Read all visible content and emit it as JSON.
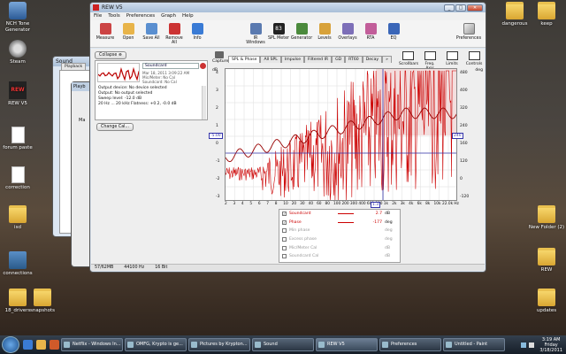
{
  "desktop": {
    "icons_left": [
      {
        "label": "NCH Tone Generator",
        "kind": "app-blue"
      },
      {
        "label": "Steam",
        "kind": "gear"
      },
      {
        "label": "REW V5",
        "kind": "rewicon"
      },
      {
        "label": "forum paste",
        "kind": "doc"
      },
      {
        "label": "correction",
        "kind": "doc"
      },
      {
        "label": "isd",
        "kind": "folder"
      },
      {
        "label": "connections",
        "kind": "conn"
      },
      {
        "label": "18_drivers",
        "kind": "folder"
      },
      {
        "label": "snapshots",
        "kind": "folder"
      }
    ],
    "icons_right": [
      {
        "label": "dangerous",
        "kind": "folder"
      },
      {
        "label": "keep",
        "kind": "folder"
      },
      {
        "label": "New Folder (2)",
        "kind": "folder"
      },
      {
        "label": "REW",
        "kind": "folder"
      },
      {
        "label": "updates",
        "kind": "folder"
      }
    ]
  },
  "sound_dialog": {
    "title": "Sound",
    "tab": "Playback",
    "tab_short": "Playb",
    "side_letters": "Ma"
  },
  "rew": {
    "title": "REW V5",
    "menu": [
      "File",
      "Tools",
      "Preferences",
      "Graph",
      "Help"
    ],
    "toolbar": [
      "Measure",
      "Open",
      "Save All",
      "Remove All",
      "Info"
    ],
    "toolbar_right": [
      "IR Windows",
      "SPL Meter",
      "Generator",
      "Levels",
      "Overlays",
      "RTA",
      "EQ"
    ],
    "spl_value": "83",
    "preferences_label": "Preferences",
    "collapse_label": "Collapse",
    "measurement": {
      "name": "Soundcard",
      "date": "Mar 18, 2011 3:09:22 AM",
      "mic": "Mic/Meter: No Cal",
      "cal": "Soundcard: No Cal",
      "info": [
        "Output device: No device selected",
        "Output: No output selected",
        "Sweep level: -12.0 dB",
        "20 Hz ... 20 kHz Flatness: +0.2, -0.0 dB"
      ]
    },
    "change_cal_label": "Change Cal...",
    "capture_label": "Capture",
    "tabs": [
      "SPL & Phase",
      "All SPL",
      "Impulse",
      "Filtered IR",
      "GD",
      "RT60",
      "Decay",
      "»"
    ],
    "right_tools": [
      "Scrollbars",
      "Freq. Axis",
      "Limits",
      "Controls"
    ],
    "status": [
      "57/62MB",
      "44100 Hz",
      "16 Bit"
    ],
    "legend": [
      {
        "name": "Soundcard",
        "checked": true,
        "color": "#cc0000",
        "value": "2.7",
        "unit": "dB",
        "active": true
      },
      {
        "name": "Phase",
        "checked": true,
        "color": "#cc0000",
        "value": "-177",
        "unit": "deg",
        "active": true
      },
      {
        "name": "Min phase",
        "checked": false,
        "color": "",
        "value": "",
        "unit": "deg",
        "active": false
      },
      {
        "name": "Excess phase",
        "checked": false,
        "color": "",
        "value": "",
        "unit": "deg",
        "active": false
      },
      {
        "name": "Mic/Meter Cal",
        "checked": false,
        "color": "",
        "value": "",
        "unit": "dB",
        "active": false
      },
      {
        "name": "Soundcard Cal",
        "checked": false,
        "color": "",
        "value": "",
        "unit": "dB",
        "active": false
      }
    ]
  },
  "graph": {
    "left_axis_unit": "dB",
    "right_axis_unit": "deg",
    "left_ticks": [
      "4",
      "3",
      "2",
      "1",
      "0",
      "-1",
      "-2",
      "-3"
    ],
    "right_ticks": [
      "480",
      "400",
      "320",
      "240",
      "160",
      "120",
      "0",
      "-120"
    ],
    "x_ticks": [
      "2",
      "3",
      "4",
      "5",
      "6",
      "7",
      "8",
      "10",
      "20",
      "30",
      "40",
      "60",
      "80",
      "100",
      "200",
      "300",
      "400",
      "600",
      "800",
      "1k",
      "2k",
      "3k",
      "4k",
      "6k",
      "8k",
      "10k",
      "22.0k Hz"
    ],
    "cursor_left": "-5.00",
    "cursor_right": "240",
    "cursor_freq": "1.3"
  },
  "taskbar": {
    "tasks": [
      "Netflix - Windows In...",
      "OMFG, Krypto is ge...",
      "Pictures by Krypton...",
      "Sound",
      "REW V5",
      "Preferences",
      "Untitled - Paint"
    ],
    "active_task": "REW V5",
    "time": "3:19 AM",
    "day": "Friday",
    "date": "3/18/2011"
  }
}
